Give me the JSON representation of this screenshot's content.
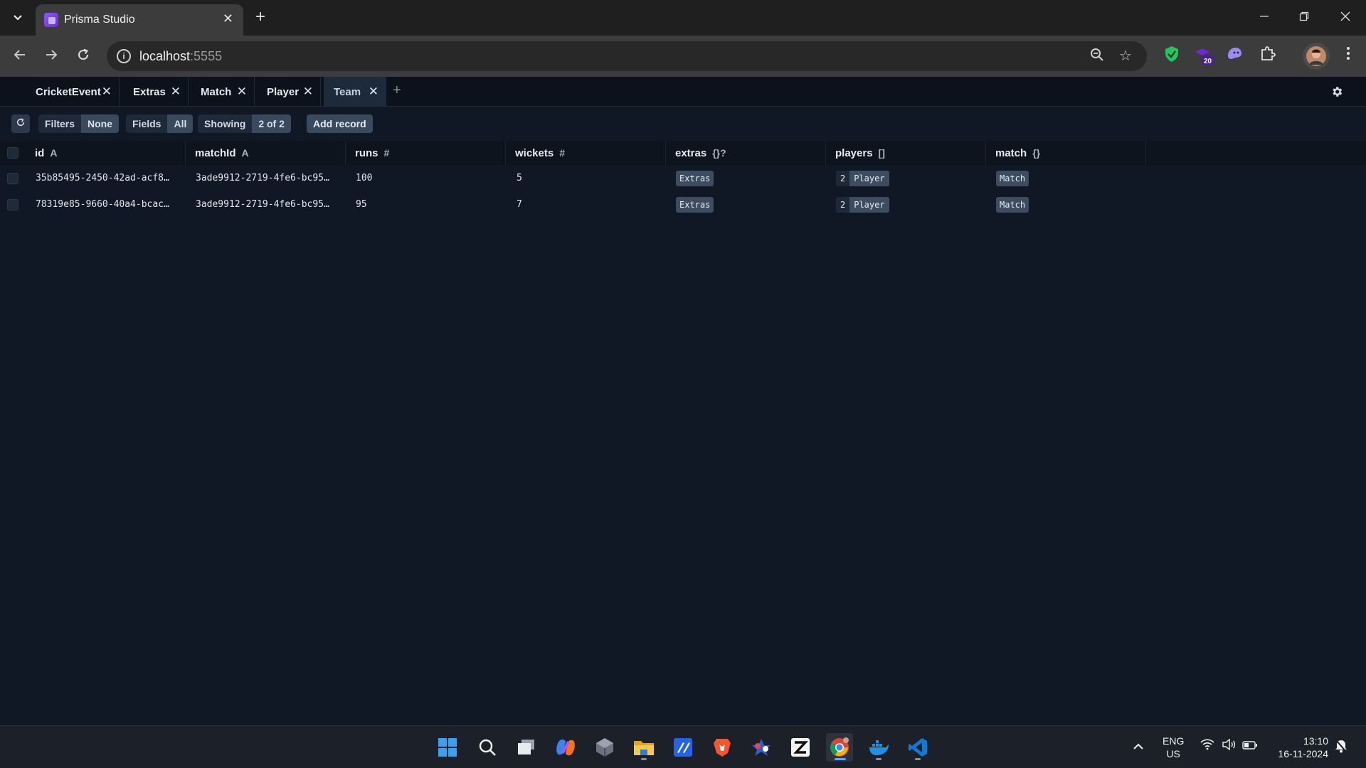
{
  "browser": {
    "tab_title": "Prisma Studio",
    "url_host": "localhost",
    "url_port": ":5555",
    "extension_badge": "20"
  },
  "studio": {
    "model_tabs": [
      {
        "label": "CricketEvent"
      },
      {
        "label": "Extras"
      },
      {
        "label": "Match"
      },
      {
        "label": "Player"
      },
      {
        "label": "Team"
      }
    ],
    "actions": {
      "filters_label": "Filters",
      "filters_value": "None",
      "fields_label": "Fields",
      "fields_value": "All",
      "showing_label": "Showing",
      "showing_value": "2 of 2",
      "add_record_label": "Add record"
    },
    "columns": [
      {
        "name": "id",
        "type": "A"
      },
      {
        "name": "matchId",
        "type": "A"
      },
      {
        "name": "runs",
        "type": "#"
      },
      {
        "name": "wickets",
        "type": "#"
      },
      {
        "name": "extras",
        "type": "{}?"
      },
      {
        "name": "players",
        "type": "[]"
      },
      {
        "name": "match",
        "type": "{}"
      }
    ],
    "rows": [
      {
        "id": "35b85495-2450-42ad-acf8…",
        "matchId": "3ade9912-2719-4fe6-bc95…",
        "runs": "100",
        "wickets": "5",
        "extras": "Extras",
        "players_count": "2",
        "players": "Player",
        "match": "Match"
      },
      {
        "id": "78319e85-9660-40a4-bcac…",
        "matchId": "3ade9912-2719-4fe6-bc95…",
        "runs": "95",
        "wickets": "7",
        "extras": "Extras",
        "players_count": "2",
        "players": "Player",
        "match": "Match"
      }
    ]
  },
  "taskbar": {
    "lang_line1": "ENG",
    "lang_line2": "US",
    "time": "13:10",
    "date": "16-11-2024"
  },
  "colors": {
    "studio_bg": "#101825",
    "active_tab": "#1d2a3b",
    "chip": "#3d4c60"
  }
}
